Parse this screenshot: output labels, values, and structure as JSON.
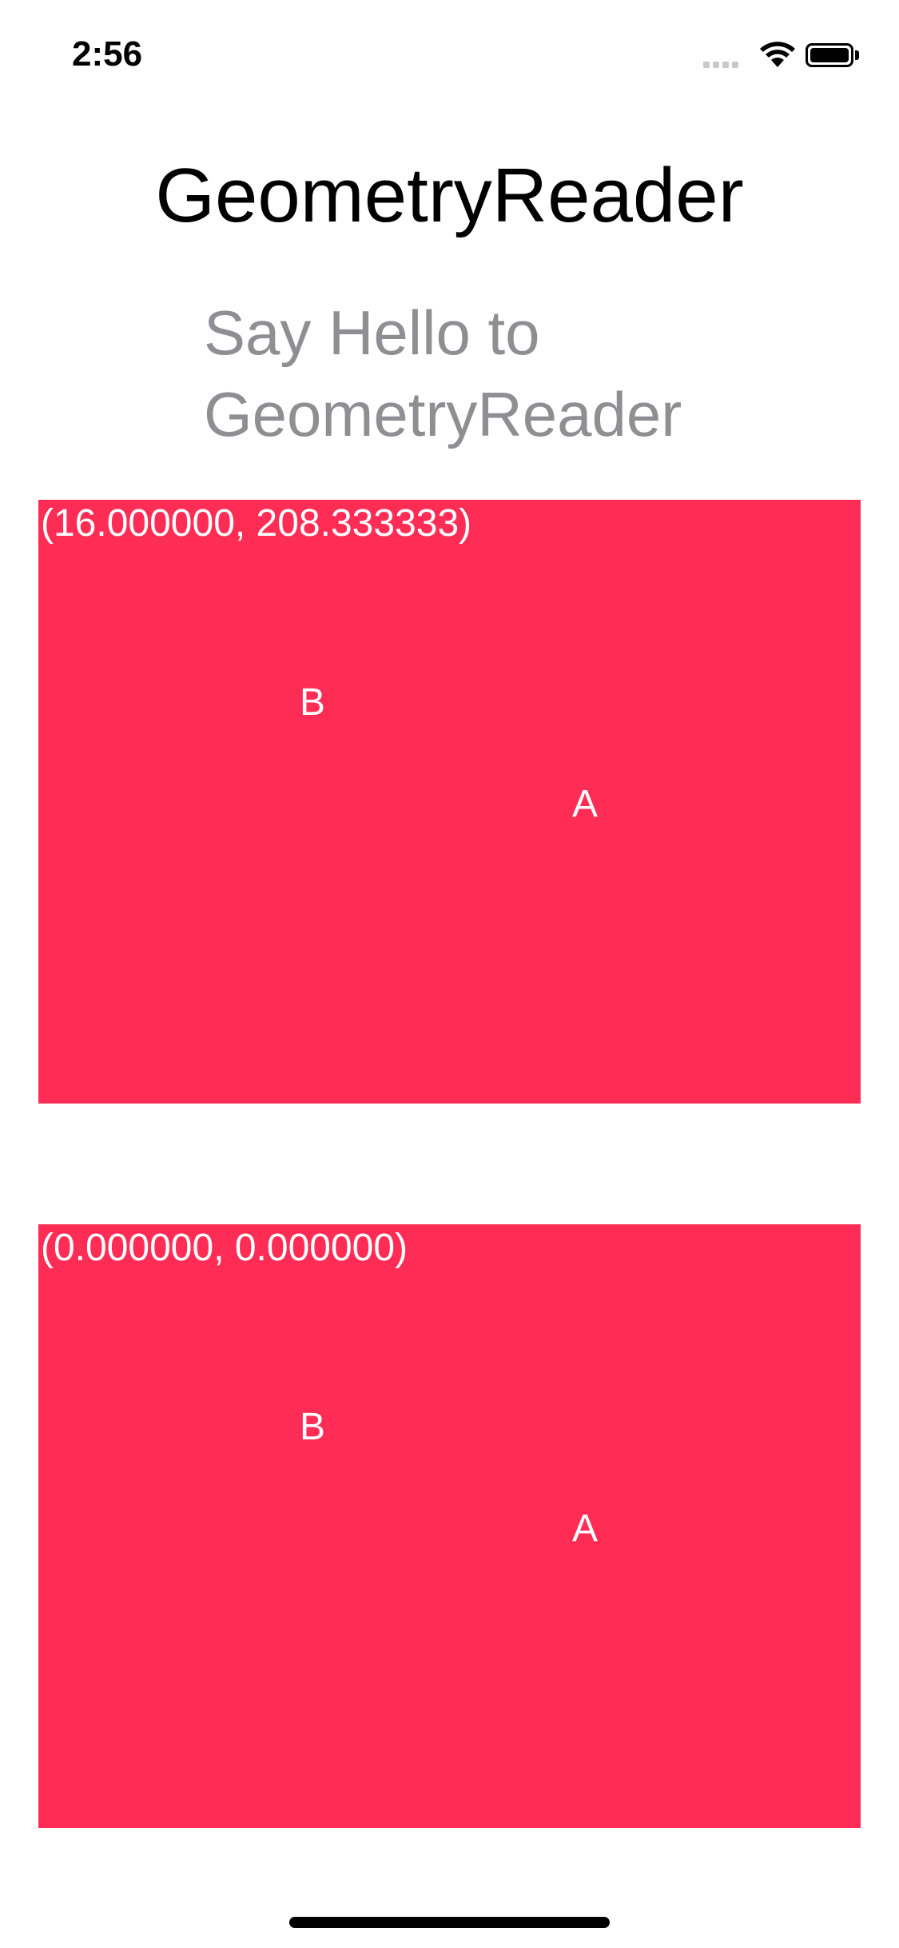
{
  "status_bar": {
    "time": "2:56"
  },
  "header": {
    "title": "GeometryReader",
    "subtitle": "Say Hello to GeometryReader"
  },
  "boxes": [
    {
      "coordinates": "(16.000000, 208.333333)",
      "label_b": "B",
      "label_a": "A"
    },
    {
      "coordinates": "(0.000000, 0.000000)",
      "label_b": "B",
      "label_a": "A"
    }
  ],
  "colors": {
    "box_fill": "#ff2d55",
    "subtitle_text": "#8e8e93",
    "title_text": "#000000"
  },
  "icons": [
    "cellular-signal-icon",
    "wifi-icon",
    "battery-icon"
  ]
}
